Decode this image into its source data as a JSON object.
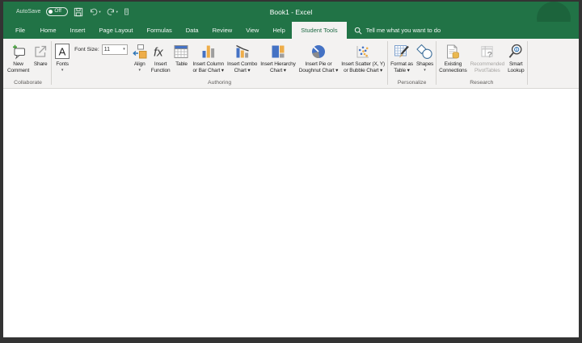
{
  "window": {
    "title": "Book1 - Excel"
  },
  "quick_access": {
    "autosave_label": "AutoSave",
    "autosave_state": "Off",
    "icons": {
      "save-icon": "floppy-disk",
      "undo-icon": "curved-arrow-left",
      "redo-icon": "curved-arrow-right",
      "customize-quick-access-icon": "small-bar"
    }
  },
  "search": {
    "icon": "search-icon",
    "placeholder": "Tell me what you want to do"
  },
  "tabs": [
    {
      "label": "File",
      "active": false
    },
    {
      "label": "Home",
      "active": false
    },
    {
      "label": "Insert",
      "active": false
    },
    {
      "label": "Page Layout",
      "active": false
    },
    {
      "label": "Formulas",
      "active": false
    },
    {
      "label": "Data",
      "active": false
    },
    {
      "label": "Review",
      "active": false
    },
    {
      "label": "View",
      "active": false
    },
    {
      "label": "Help",
      "active": false
    },
    {
      "label": "Student Tools",
      "active": true
    }
  ],
  "ribbon": {
    "groups": [
      {
        "label": "Collaborate",
        "buttons": [
          {
            "name": "new-comment",
            "icon": "comment-plus-icon",
            "lines": [
              "New",
              "Comment"
            ],
            "dropdown": false
          },
          {
            "name": "share",
            "icon": "share-icon",
            "lines": [
              "Share"
            ],
            "dropdown": false
          }
        ]
      },
      {
        "label": "Authoring",
        "buttons": [
          {
            "name": "fonts",
            "icon": "fonts-icon",
            "lines": [
              "Fonts"
            ],
            "dropdown": true
          },
          {
            "type": "fontsize",
            "name": "font-size",
            "label": "Font Size:",
            "value": "11"
          },
          {
            "name": "align",
            "icon": "align-icon",
            "lines": [
              "Align"
            ],
            "dropdown": true
          },
          {
            "name": "insert-function",
            "icon": "function-icon",
            "lines": [
              "Insert",
              "Function"
            ],
            "dropdown": false
          },
          {
            "name": "table",
            "icon": "table-icon",
            "lines": [
              "Table"
            ],
            "dropdown": false
          },
          {
            "name": "insert-column-or-bar-chart",
            "icon": "column-chart-icon",
            "lines": [
              "Insert Column",
              "or Bar Chart ▾"
            ],
            "dropdown": false
          },
          {
            "name": "insert-combo-chart",
            "icon": "combo-chart-icon",
            "lines": [
              "Insert Combo",
              "Chart ▾"
            ],
            "dropdown": false
          },
          {
            "name": "insert-hierarchy-chart",
            "icon": "hierarchy-chart-icon",
            "lines": [
              "Insert Hierarchy",
              "Chart ▾"
            ],
            "dropdown": false
          },
          {
            "name": "insert-pie-or-doughnut-chart",
            "icon": "pie-chart-icon",
            "lines": [
              "Insert Pie or",
              "Doughnut Chart ▾"
            ],
            "dropdown": false
          },
          {
            "name": "insert-scatter-or-bubble-chart",
            "icon": "scatter-chart-icon",
            "lines": [
              "Insert Scatter (X, Y)",
              "or Bubble Chart ▾"
            ],
            "dropdown": false
          }
        ]
      },
      {
        "label": "Personalize",
        "buttons": [
          {
            "name": "format-as-table",
            "icon": "format-table-icon",
            "lines": [
              "Format as",
              "Table ▾"
            ],
            "dropdown": false
          },
          {
            "name": "shapes",
            "icon": "shapes-icon",
            "lines": [
              "Shapes"
            ],
            "dropdown": true
          }
        ]
      },
      {
        "label": "Research",
        "buttons": [
          {
            "name": "existing-connections",
            "icon": "connections-icon",
            "lines": [
              "Existing",
              "Connections"
            ],
            "dropdown": false
          },
          {
            "name": "recommended-pivottables",
            "icon": "pivottable-question-icon",
            "lines": [
              "Recommended",
              "PivotTables"
            ],
            "dropdown": false,
            "disabled": true
          },
          {
            "name": "smart-lookup",
            "icon": "smart-lookup-icon",
            "lines": [
              "Smart",
              "Lookup"
            ],
            "dropdown": false
          }
        ]
      }
    ]
  },
  "colors": {
    "titlebar_green": "#217346",
    "active_tab_text": "#1e6b45",
    "ribbon_bg": "#f3f2f1",
    "accent_blue": "#4472c4",
    "accent_gold": "#eead49",
    "accent_gray": "#9e9e9e",
    "frame_border": "#333333"
  }
}
